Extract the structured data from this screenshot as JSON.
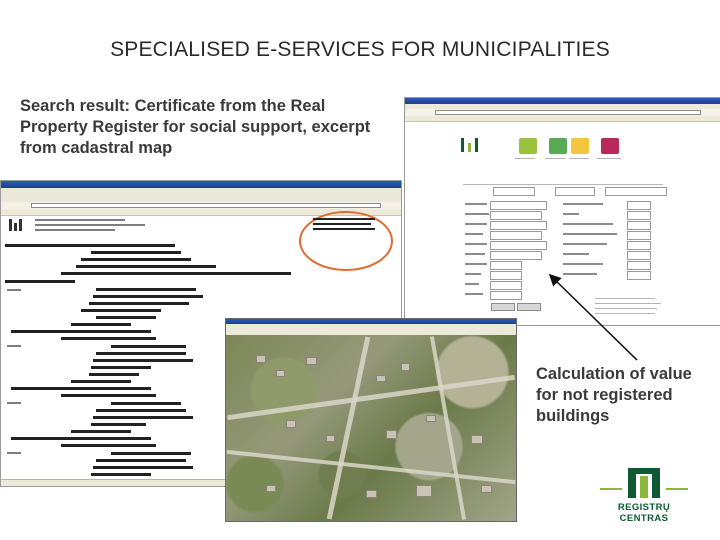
{
  "slide": {
    "title": "SPECIALISED E-SERVICES FOR MUNICIPALITIES",
    "subtitle": "Search result: Certificate from the Real Property Register for social support, excerpt from cadastral map",
    "callout": "Calculation of value for not registered buildings"
  },
  "logo": {
    "name": "REGISTRŲ CENTRAS",
    "color": "#0f5a32",
    "accent": "#8db63a"
  },
  "colors": {
    "oval": "#e06a30",
    "arrow": "#111111",
    "titlebar": "#2c5bb8"
  }
}
